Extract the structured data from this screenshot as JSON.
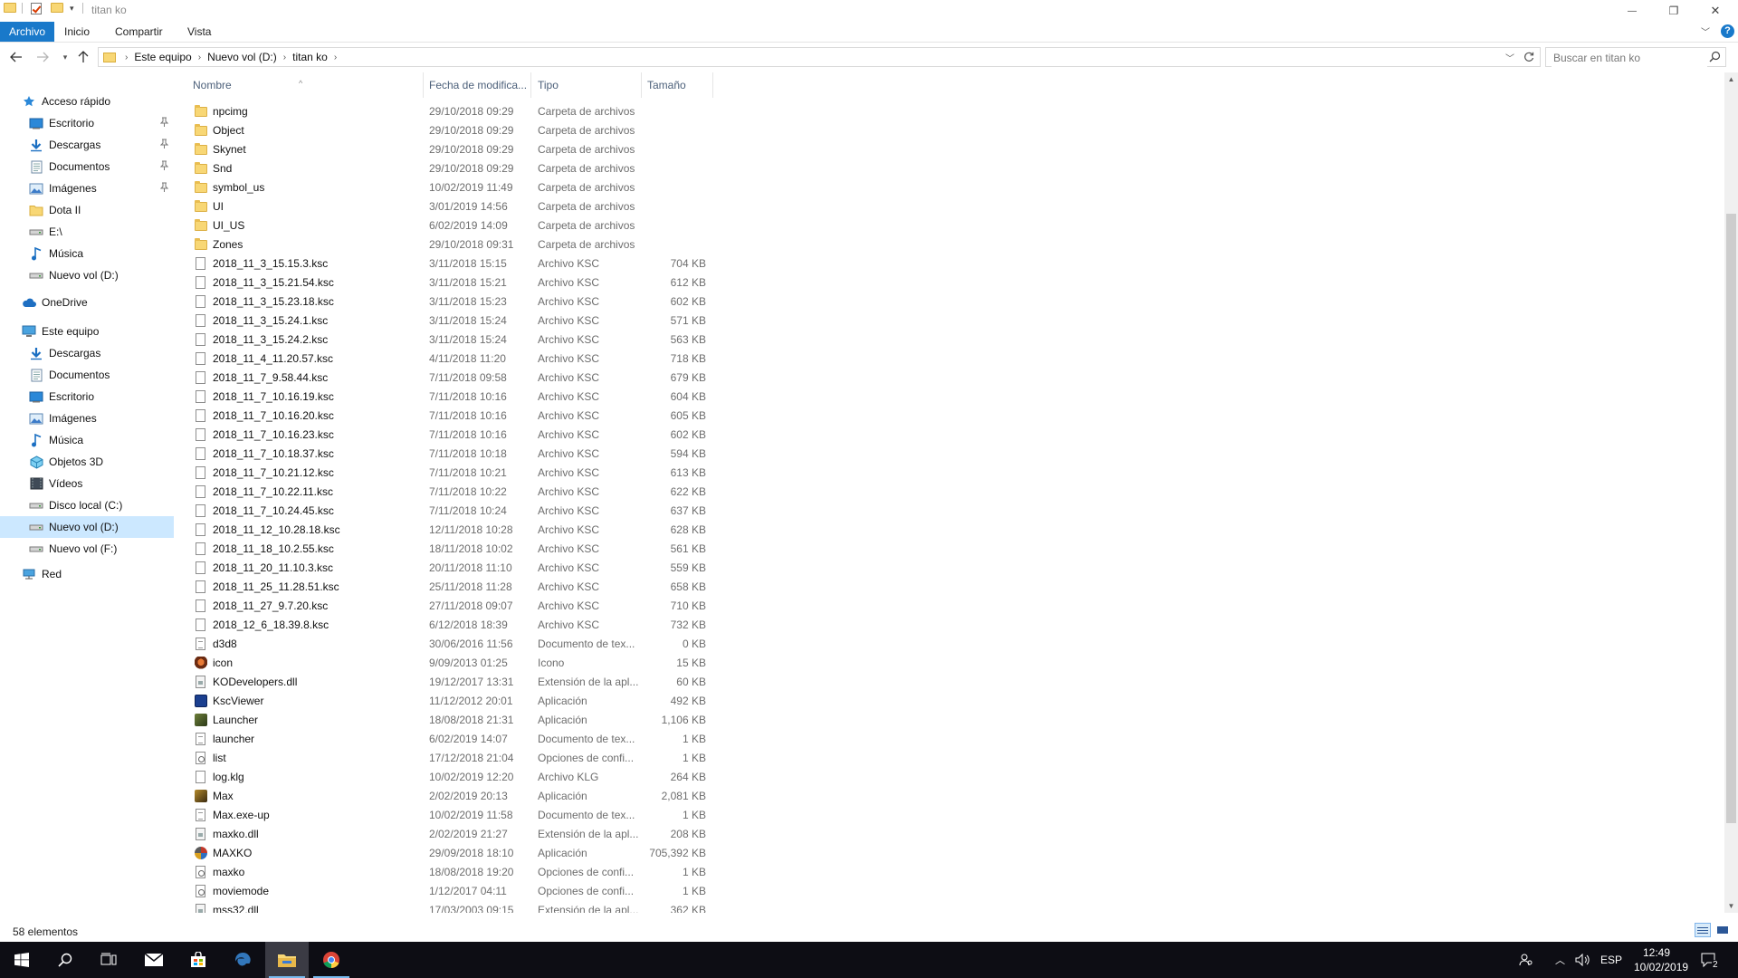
{
  "window": {
    "title": "titan ko",
    "minimize": "—",
    "maximize": "❐",
    "close": "✕"
  },
  "ribbon": {
    "tabs": [
      "Archivo",
      "Inicio",
      "Compartir",
      "Vista"
    ]
  },
  "address": {
    "crumbs": [
      "Este equipo",
      "Nuevo vol (D:)",
      "titan ko"
    ]
  },
  "search": {
    "placeholder": "Buscar en titan ko"
  },
  "nav": {
    "quick_access": "Acceso rápido",
    "quick_items": [
      {
        "label": "Escritorio",
        "icon": "desktop-icon",
        "pinned": true
      },
      {
        "label": "Descargas",
        "icon": "download-icon",
        "pinned": true
      },
      {
        "label": "Documentos",
        "icon": "documents-icon",
        "pinned": true
      },
      {
        "label": "Imágenes",
        "icon": "pictures-icon",
        "pinned": true
      },
      {
        "label": "Dota II",
        "icon": "folder-icon",
        "pinned": false
      },
      {
        "label": "E:\\",
        "icon": "drive-icon",
        "pinned": false
      },
      {
        "label": "Música",
        "icon": "music-icon",
        "pinned": false
      },
      {
        "label": "Nuevo vol (D:)",
        "icon": "drive-icon",
        "pinned": false
      }
    ],
    "onedrive": "OneDrive",
    "this_pc": "Este equipo",
    "pc_items": [
      {
        "label": "Descargas",
        "icon": "download-icon"
      },
      {
        "label": "Documentos",
        "icon": "documents-icon"
      },
      {
        "label": "Escritorio",
        "icon": "desktop-icon"
      },
      {
        "label": "Imágenes",
        "icon": "pictures-icon"
      },
      {
        "label": "Música",
        "icon": "music-icon"
      },
      {
        "label": "Objetos 3D",
        "icon": "cube-3d-icon"
      },
      {
        "label": "Vídeos",
        "icon": "videos-icon"
      },
      {
        "label": "Disco local (C:)",
        "icon": "drive-icon"
      },
      {
        "label": "Nuevo vol (D:)",
        "icon": "drive-icon",
        "selected": true
      },
      {
        "label": "Nuevo vol (F:)",
        "icon": "drive-icon"
      }
    ],
    "network": "Red"
  },
  "columns": {
    "name": "Nombre",
    "date": "Fecha de modifica...",
    "type": "Tipo",
    "size": "Tamaño"
  },
  "files": [
    {
      "name": "npcimg",
      "date": "29/10/2018 09:29",
      "type": "Carpeta de archivos",
      "size": "",
      "icon": "folder"
    },
    {
      "name": "Object",
      "date": "29/10/2018 09:29",
      "type": "Carpeta de archivos",
      "size": "",
      "icon": "folder"
    },
    {
      "name": "Skynet",
      "date": "29/10/2018 09:29",
      "type": "Carpeta de archivos",
      "size": "",
      "icon": "folder"
    },
    {
      "name": "Snd",
      "date": "29/10/2018 09:29",
      "type": "Carpeta de archivos",
      "size": "",
      "icon": "folder"
    },
    {
      "name": "symbol_us",
      "date": "10/02/2019 11:49",
      "type": "Carpeta de archivos",
      "size": "",
      "icon": "folder"
    },
    {
      "name": "UI",
      "date": "3/01/2019 14:56",
      "type": "Carpeta de archivos",
      "size": "",
      "icon": "folder"
    },
    {
      "name": "UI_US",
      "date": "6/02/2019 14:09",
      "type": "Carpeta de archivos",
      "size": "",
      "icon": "folder"
    },
    {
      "name": "Zones",
      "date": "29/10/2018 09:31",
      "type": "Carpeta de archivos",
      "size": "",
      "icon": "folder"
    },
    {
      "name": "2018_11_3_15.15.3.ksc",
      "date": "3/11/2018 15:15",
      "type": "Archivo KSC",
      "size": "704 KB",
      "icon": "doc"
    },
    {
      "name": "2018_11_3_15.21.54.ksc",
      "date": "3/11/2018 15:21",
      "type": "Archivo KSC",
      "size": "612 KB",
      "icon": "doc"
    },
    {
      "name": "2018_11_3_15.23.18.ksc",
      "date": "3/11/2018 15:23",
      "type": "Archivo KSC",
      "size": "602 KB",
      "icon": "doc"
    },
    {
      "name": "2018_11_3_15.24.1.ksc",
      "date": "3/11/2018 15:24",
      "type": "Archivo KSC",
      "size": "571 KB",
      "icon": "doc"
    },
    {
      "name": "2018_11_3_15.24.2.ksc",
      "date": "3/11/2018 15:24",
      "type": "Archivo KSC",
      "size": "563 KB",
      "icon": "doc"
    },
    {
      "name": "2018_11_4_11.20.57.ksc",
      "date": "4/11/2018 11:20",
      "type": "Archivo KSC",
      "size": "718 KB",
      "icon": "doc"
    },
    {
      "name": "2018_11_7_9.58.44.ksc",
      "date": "7/11/2018 09:58",
      "type": "Archivo KSC",
      "size": "679 KB",
      "icon": "doc"
    },
    {
      "name": "2018_11_7_10.16.19.ksc",
      "date": "7/11/2018 10:16",
      "type": "Archivo KSC",
      "size": "604 KB",
      "icon": "doc"
    },
    {
      "name": "2018_11_7_10.16.20.ksc",
      "date": "7/11/2018 10:16",
      "type": "Archivo KSC",
      "size": "605 KB",
      "icon": "doc"
    },
    {
      "name": "2018_11_7_10.16.23.ksc",
      "date": "7/11/2018 10:16",
      "type": "Archivo KSC",
      "size": "602 KB",
      "icon": "doc"
    },
    {
      "name": "2018_11_7_10.18.37.ksc",
      "date": "7/11/2018 10:18",
      "type": "Archivo KSC",
      "size": "594 KB",
      "icon": "doc"
    },
    {
      "name": "2018_11_7_10.21.12.ksc",
      "date": "7/11/2018 10:21",
      "type": "Archivo KSC",
      "size": "613 KB",
      "icon": "doc"
    },
    {
      "name": "2018_11_7_10.22.11.ksc",
      "date": "7/11/2018 10:22",
      "type": "Archivo KSC",
      "size": "622 KB",
      "icon": "doc"
    },
    {
      "name": "2018_11_7_10.24.45.ksc",
      "date": "7/11/2018 10:24",
      "type": "Archivo KSC",
      "size": "637 KB",
      "icon": "doc"
    },
    {
      "name": "2018_11_12_10.28.18.ksc",
      "date": "12/11/2018 10:28",
      "type": "Archivo KSC",
      "size": "628 KB",
      "icon": "doc"
    },
    {
      "name": "2018_11_18_10.2.55.ksc",
      "date": "18/11/2018 10:02",
      "type": "Archivo KSC",
      "size": "561 KB",
      "icon": "doc"
    },
    {
      "name": "2018_11_20_11.10.3.ksc",
      "date": "20/11/2018 11:10",
      "type": "Archivo KSC",
      "size": "559 KB",
      "icon": "doc"
    },
    {
      "name": "2018_11_25_11.28.51.ksc",
      "date": "25/11/2018 11:28",
      "type": "Archivo KSC",
      "size": "658 KB",
      "icon": "doc"
    },
    {
      "name": "2018_11_27_9.7.20.ksc",
      "date": "27/11/2018 09:07",
      "type": "Archivo KSC",
      "size": "710 KB",
      "icon": "doc"
    },
    {
      "name": "2018_12_6_18.39.8.ksc",
      "date": "6/12/2018 18:39",
      "type": "Archivo KSC",
      "size": "732 KB",
      "icon": "doc"
    },
    {
      "name": "d3d8",
      "date": "30/06/2016 11:56",
      "type": "Documento de tex...",
      "size": "0 KB",
      "icon": "txt"
    },
    {
      "name": "icon",
      "date": "9/09/2013 01:25",
      "type": "Icono",
      "size": "15 KB",
      "icon": "ico"
    },
    {
      "name": "KODevelopers.dll",
      "date": "19/12/2017 13:31",
      "type": "Extensión de la apl...",
      "size": "60 KB",
      "icon": "dll"
    },
    {
      "name": "KscViewer",
      "date": "11/12/2012 20:01",
      "type": "Aplicación",
      "size": "492 KB",
      "icon": "app-blue"
    },
    {
      "name": "Launcher",
      "date": "18/08/2018 21:31",
      "type": "Aplicación",
      "size": "1,106 KB",
      "icon": "app-launcher"
    },
    {
      "name": "launcher",
      "date": "6/02/2019 14:07",
      "type": "Documento de tex...",
      "size": "1 KB",
      "icon": "txt"
    },
    {
      "name": "list",
      "date": "17/12/2018 21:04",
      "type": "Opciones de confi...",
      "size": "1 KB",
      "icon": "cfg"
    },
    {
      "name": "log.klg",
      "date": "10/02/2019 12:20",
      "type": "Archivo KLG",
      "size": "264 KB",
      "icon": "doc"
    },
    {
      "name": "Max",
      "date": "2/02/2019 20:13",
      "type": "Aplicación",
      "size": "2,081 KB",
      "icon": "app-max"
    },
    {
      "name": "Max.exe-up",
      "date": "10/02/2019 11:58",
      "type": "Documento de tex...",
      "size": "1 KB",
      "icon": "txt"
    },
    {
      "name": "maxko.dll",
      "date": "2/02/2019 21:27",
      "type": "Extensión de la apl...",
      "size": "208 KB",
      "icon": "dll"
    },
    {
      "name": "MAXKO",
      "date": "29/09/2018 18:10",
      "type": "Aplicación",
      "size": "705,392 KB",
      "icon": "app-maxko"
    },
    {
      "name": "maxko",
      "date": "18/08/2018 19:20",
      "type": "Opciones de confi...",
      "size": "1 KB",
      "icon": "cfg"
    },
    {
      "name": "moviemode",
      "date": "1/12/2017 04:11",
      "type": "Opciones de confi...",
      "size": "1 KB",
      "icon": "cfg"
    },
    {
      "name": "mss32.dll",
      "date": "17/03/2003 09:15",
      "type": "Extensión de la apl...",
      "size": "362 KB",
      "icon": "dll"
    }
  ],
  "status": {
    "count": "58 elementos"
  },
  "taskbar": {
    "lang": "ESP",
    "time": "12:49",
    "date": "10/02/2019",
    "notifications": "2"
  },
  "colors": {
    "accent": "#1979ca",
    "selection": "#cce8ff",
    "folder": "#f8d775",
    "taskbar": "#0d0d14"
  }
}
